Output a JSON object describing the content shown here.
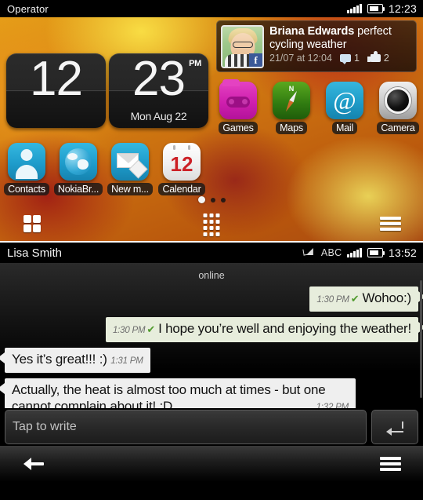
{
  "home": {
    "statusbar": {
      "operator": "Operator",
      "time": "12:23",
      "signal_icon": "signal-bars-icon",
      "battery_icon": "battery-icon"
    },
    "clock_widget": {
      "hours": "12",
      "minutes": "23",
      "ampm": "PM",
      "date": "Mon Aug 22"
    },
    "facebook_widget": {
      "author": "Briana Edwards",
      "message": " perfect cycling weather",
      "timestamp": "21/07 at 12:04",
      "comments_count": "1",
      "likes_count": "2",
      "badge": "f",
      "comment_icon": "comment-bubble-icon",
      "like_icon": "thumbs-up-icon"
    },
    "icons_row1": [
      {
        "label": "Games",
        "icon": "games-gamepad-icon"
      },
      {
        "label": "Maps",
        "icon": "maps-compass-icon",
        "north": "N"
      },
      {
        "label": "Mail",
        "icon": "mail-at-icon",
        "glyph": "@"
      },
      {
        "label": "Camera",
        "icon": "camera-lens-icon"
      }
    ],
    "icons_row2": [
      {
        "label": "Contacts",
        "icon": "contacts-person-icon"
      },
      {
        "label": "NokiaBr...",
        "icon": "browser-globe-icon"
      },
      {
        "label": "New m...",
        "icon": "new-message-envelope-icon"
      },
      {
        "label": "Calendar",
        "icon": "calendar-icon",
        "day": "12"
      }
    ],
    "pages": {
      "count": 3,
      "active": 1
    },
    "dock": {
      "apps_icon": "app-grid-icon",
      "dialer_icon": "dialer-keypad-icon",
      "menu_icon": "hamburger-menu-icon"
    }
  },
  "chat": {
    "statusbar": {
      "contact": "Lisa Smith",
      "input_mode": "ABC",
      "input_mode_icon": "text-input-pen-icon",
      "time": "13:52",
      "signal_icon": "signal-bars-icon",
      "battery_icon": "battery-icon"
    },
    "presence": "online",
    "messages": [
      {
        "direction": "sent",
        "time": "1:30 PM",
        "text": "Wohoo:)",
        "status_icon": "delivered-check-icon"
      },
      {
        "direction": "sent",
        "time": "1:30 PM",
        "text": "I hope you’re well and enjoying the weather!",
        "status_icon": "delivered-check-icon"
      },
      {
        "direction": "received",
        "time": "1:31 PM",
        "text": "Yes it’s great!!! :)"
      },
      {
        "direction": "received",
        "time": "1:32 PM",
        "text": "Actually, the heat is almost too much at times - but one cannot complain about it! :D"
      }
    ],
    "composer": {
      "placeholder": "Tap to write",
      "value": "",
      "send_icon": "enter-return-icon"
    },
    "bottombar": {
      "back_icon": "back-arrow-icon",
      "menu_icon": "hamburger-menu-icon"
    }
  }
}
